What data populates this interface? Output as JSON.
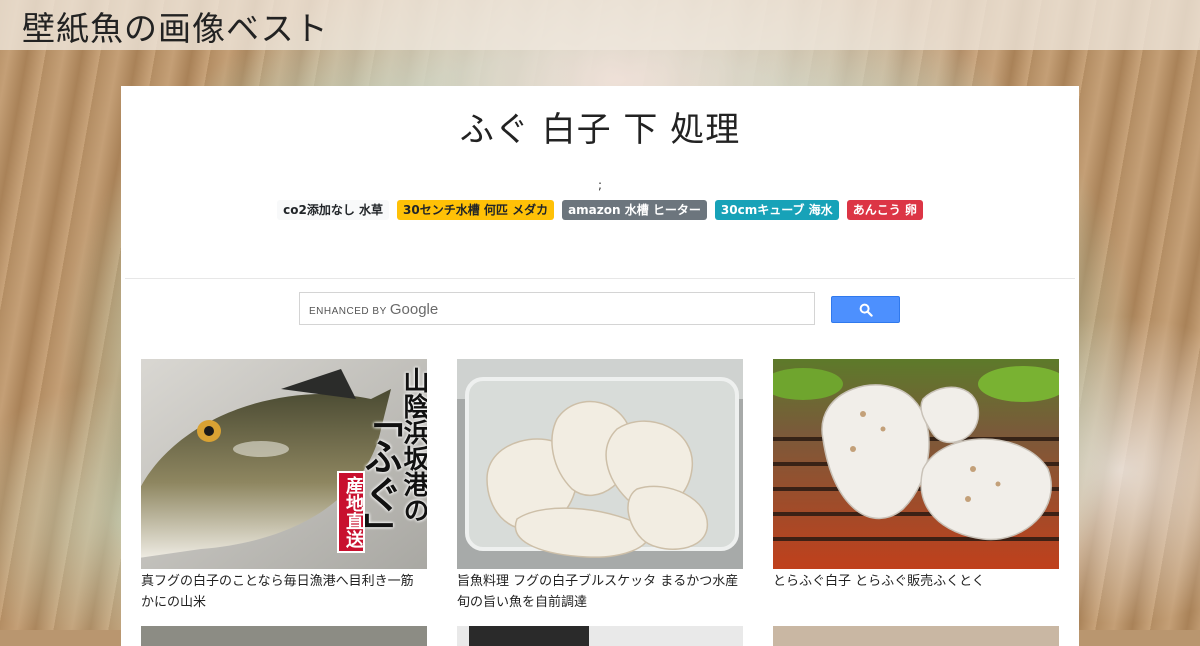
{
  "site": {
    "title": "壁紙魚の画像ベスト"
  },
  "page": {
    "title": "ふぐ 白子 下 処理",
    "separator": ";"
  },
  "tags": [
    {
      "label": "co2添加なし 水草",
      "style": "light"
    },
    {
      "label": "30センチ水槽 何匹 メダカ",
      "style": "warning"
    },
    {
      "label": "amazon 水槽 ヒーター",
      "style": "secondary"
    },
    {
      "label": "30cmキューブ 海水",
      "style": "info"
    },
    {
      "label": "あんこう 卵",
      "style": "danger"
    }
  ],
  "search": {
    "brand_prefix": "ENHANCED BY",
    "brand_name": "Google"
  },
  "cards": [
    {
      "caption": "真フグの白子のことなら毎日漁港へ目利き一筋 かにの山米",
      "image_text": [
        "山陰浜坂港の",
        "「ふぐ」",
        "産地直送"
      ]
    },
    {
      "caption": "旨魚料理 フグの白子ブルスケッタ まるかつ水産 旬の旨い魚を自前調達"
    },
    {
      "caption": "とらふぐ白子 とらふぐ販売ふくとく"
    }
  ],
  "colors": {
    "tag_warning": "#ffc107",
    "tag_secondary": "#6c757d",
    "tag_info": "#17a2b8",
    "tag_danger": "#dc3545",
    "search_button": "#4d90fe"
  }
}
